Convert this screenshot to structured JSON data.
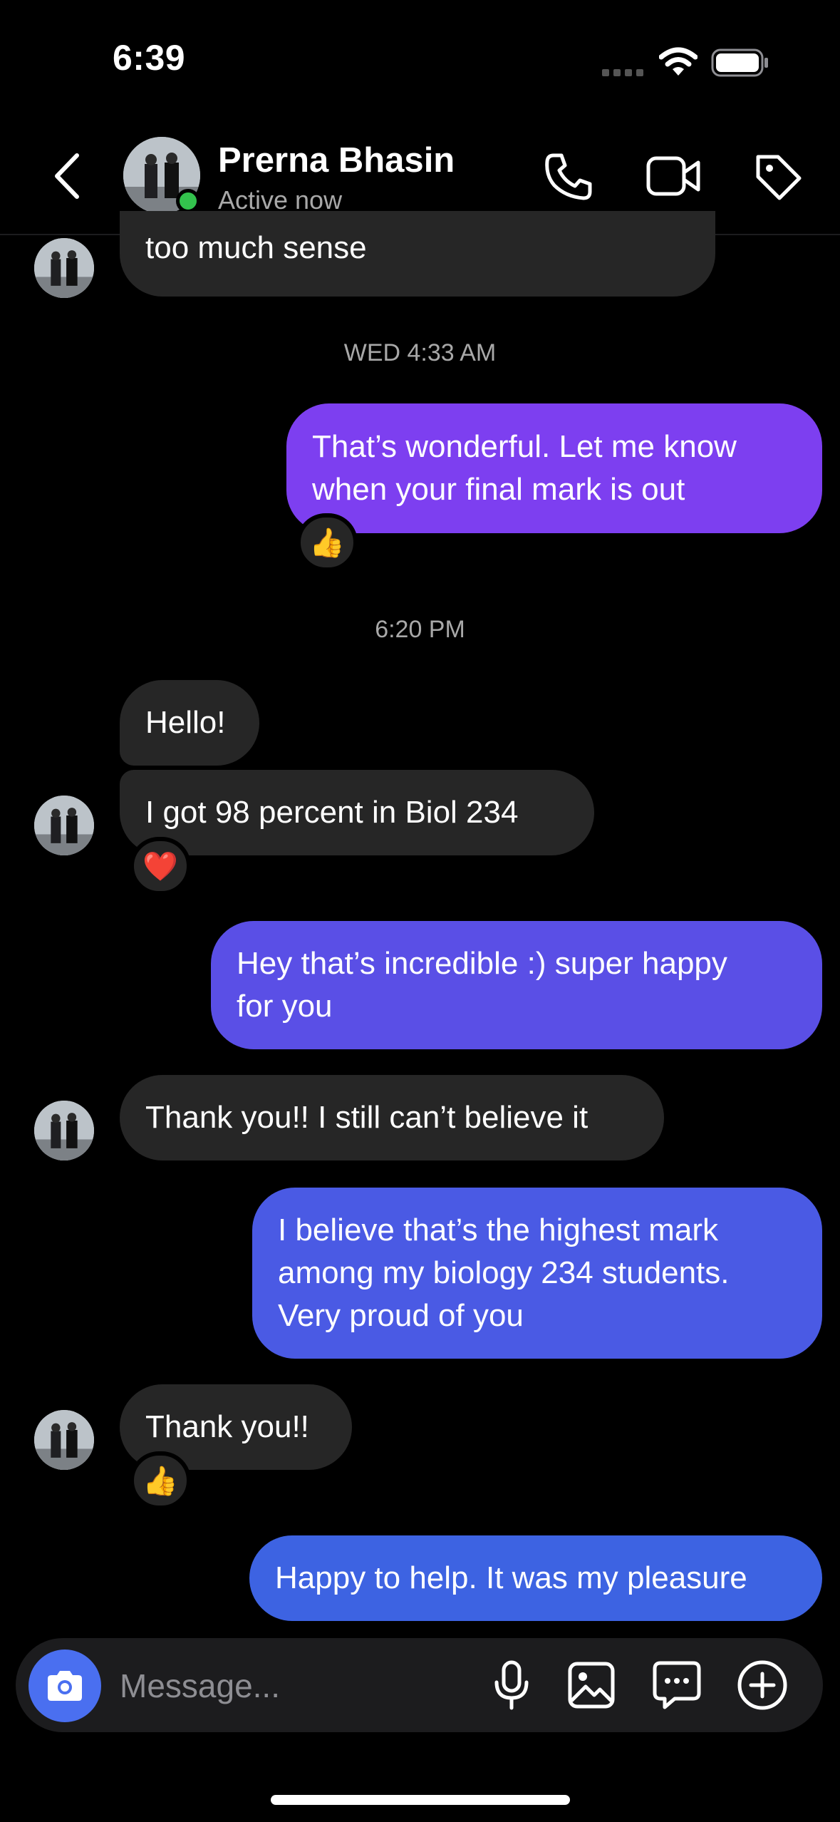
{
  "status_bar": {
    "time": "6:39"
  },
  "header": {
    "contact_name": "Prerna Bhasin",
    "contact_status": "Active now",
    "icons": [
      "back-chevron-icon",
      "phone-icon",
      "video-camera-icon",
      "tag-icon"
    ]
  },
  "colors": {
    "incoming_bubble": "#262626",
    "outgoing_top": "#7d3ff0",
    "outgoing_bottom": "#3d63e2",
    "online": "#33c24d",
    "camera_button": "#4a6ff0"
  },
  "messages": {
    "m0": {
      "text": "too much sense"
    },
    "stamp1": "WED 4:33 AM",
    "m1": {
      "line1": "That’s wonderful. Let me know",
      "line2": "when your final mark is out",
      "reaction": "👍"
    },
    "stamp2": "6:20 PM",
    "m2": {
      "text": "Hello!"
    },
    "m3": {
      "text": "I got 98 percent in Biol 234",
      "reaction": "❤️"
    },
    "m4": {
      "line1": "Hey that’s incredible :) super happy",
      "line2": "for you"
    },
    "m5": {
      "text": "Thank you!! I still can’t believe it"
    },
    "m6": {
      "line1": "I believe that’s the highest mark",
      "line2": "among my biology 234 students.",
      "line3": "Very proud of you"
    },
    "m7": {
      "text": "Thank you!!",
      "reaction": "👍"
    },
    "m8": {
      "text": "Happy to help. It was my pleasure"
    }
  },
  "composer": {
    "placeholder": "Message...",
    "icons": [
      "camera-icon",
      "microphone-icon",
      "gallery-icon",
      "sticker-icon",
      "add-icon"
    ]
  }
}
